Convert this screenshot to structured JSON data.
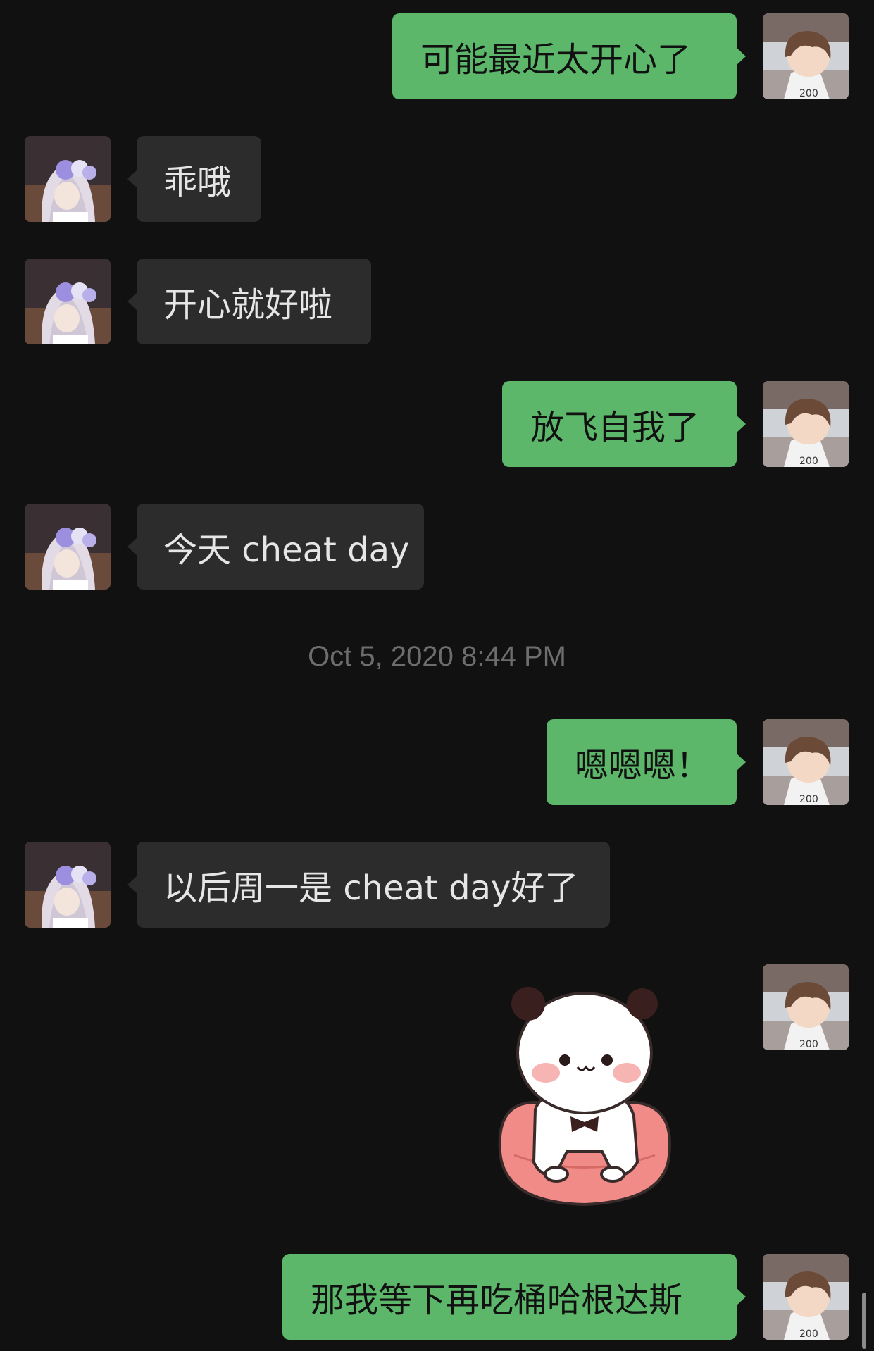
{
  "colors": {
    "background": "#111111",
    "incoming_bubble": "#2c2c2c",
    "outgoing_bubble": "#5cb76a",
    "incoming_text": "#e6e6e6",
    "outgoing_text": "#111111",
    "timestamp_text": "#6d6d6d"
  },
  "chat": {
    "messages": [
      {
        "sender": "me",
        "text": "可能最近太开心了"
      },
      {
        "sender": "other",
        "text": "乖哦"
      },
      {
        "sender": "other",
        "text": "开心就好啦"
      },
      {
        "sender": "me",
        "text": "放飞自我了"
      },
      {
        "sender": "other",
        "text": "今天 cheat day"
      },
      {
        "sender": "me",
        "text": "嗯嗯嗯！"
      },
      {
        "sender": "other",
        "text": "以后周一是 cheat day好了"
      },
      {
        "sender": "me",
        "sticker": "panda-sitting-on-cushion-sticker"
      },
      {
        "sender": "me",
        "text": "那我等下再吃桶哈根达斯"
      }
    ],
    "timestamp": "Oct 5, 2020 8:44 PM"
  },
  "icons": {
    "my_avatar": "anime-boy-avatar-icon",
    "other_avatar": "anime-girl-avatar-icon",
    "sticker": "panda-sitting-on-cushion-sticker"
  }
}
